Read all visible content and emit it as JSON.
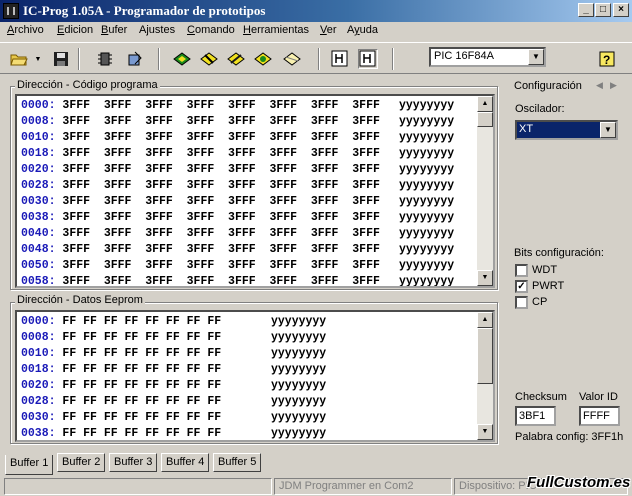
{
  "window": {
    "title": "IC-Prog 1.05A - Programador de prototipos",
    "buttons": {
      "minimize": "_",
      "maximize": "□",
      "close": "×"
    }
  },
  "menu": {
    "items": [
      {
        "label": "Archivo",
        "accel": "A"
      },
      {
        "label": "Edicion",
        "accel": "E"
      },
      {
        "label": "Bufer",
        "accel": "B"
      },
      {
        "label": "Ajustes",
        "accel": "j"
      },
      {
        "label": "Comando",
        "accel": "C"
      },
      {
        "label": "Herramientas",
        "accel": "H"
      },
      {
        "label": "Ver",
        "accel": "V"
      },
      {
        "label": "Ayuda",
        "accel": "y"
      }
    ]
  },
  "toolbar": {
    "icons": [
      "open-folder-icon",
      "dropdown-arrow-icon",
      "save-disk-icon",
      "read-chip-icon",
      "write-chip-icon",
      "read-device-icon",
      "program-device-icon",
      "erase-device-icon",
      "verify-device-icon",
      "blank-check-icon",
      "view-hex-icon",
      "view-asm-icon",
      "help-icon"
    ],
    "device": "PIC 16F84A"
  },
  "code_panel": {
    "title": "Dirección - Código programa",
    "rows": [
      {
        "addr": "0000:",
        "words": "3FFF  3FFF  3FFF  3FFF  3FFF  3FFF  3FFF  3FFF",
        "ascii": "yyyyyyyy"
      },
      {
        "addr": "0008:",
        "words": "3FFF  3FFF  3FFF  3FFF  3FFF  3FFF  3FFF  3FFF",
        "ascii": "yyyyyyyy"
      },
      {
        "addr": "0010:",
        "words": "3FFF  3FFF  3FFF  3FFF  3FFF  3FFF  3FFF  3FFF",
        "ascii": "yyyyyyyy"
      },
      {
        "addr": "0018:",
        "words": "3FFF  3FFF  3FFF  3FFF  3FFF  3FFF  3FFF  3FFF",
        "ascii": "yyyyyyyy"
      },
      {
        "addr": "0020:",
        "words": "3FFF  3FFF  3FFF  3FFF  3FFF  3FFF  3FFF  3FFF",
        "ascii": "yyyyyyyy"
      },
      {
        "addr": "0028:",
        "words": "3FFF  3FFF  3FFF  3FFF  3FFF  3FFF  3FFF  3FFF",
        "ascii": "yyyyyyyy"
      },
      {
        "addr": "0030:",
        "words": "3FFF  3FFF  3FFF  3FFF  3FFF  3FFF  3FFF  3FFF",
        "ascii": "yyyyyyyy"
      },
      {
        "addr": "0038:",
        "words": "3FFF  3FFF  3FFF  3FFF  3FFF  3FFF  3FFF  3FFF",
        "ascii": "yyyyyyyy"
      },
      {
        "addr": "0040:",
        "words": "3FFF  3FFF  3FFF  3FFF  3FFF  3FFF  3FFF  3FFF",
        "ascii": "yyyyyyyy"
      },
      {
        "addr": "0048:",
        "words": "3FFF  3FFF  3FFF  3FFF  3FFF  3FFF  3FFF  3FFF",
        "ascii": "yyyyyyyy"
      },
      {
        "addr": "0050:",
        "words": "3FFF  3FFF  3FFF  3FFF  3FFF  3FFF  3FFF  3FFF",
        "ascii": "yyyyyyyy"
      },
      {
        "addr": "0058:",
        "words": "3FFF  3FFF  3FFF  3FFF  3FFF  3FFF  3FFF  3FFF",
        "ascii": "yyyyyyyy"
      }
    ]
  },
  "eeprom_panel": {
    "title": "Dirección - Datos Eeprom",
    "rows": [
      {
        "addr": "0000:",
        "bytes": "FF FF FF FF FF FF FF FF",
        "ascii": "yyyyyyyy"
      },
      {
        "addr": "0008:",
        "bytes": "FF FF FF FF FF FF FF FF",
        "ascii": "yyyyyyyy"
      },
      {
        "addr": "0010:",
        "bytes": "FF FF FF FF FF FF FF FF",
        "ascii": "yyyyyyyy"
      },
      {
        "addr": "0018:",
        "bytes": "FF FF FF FF FF FF FF FF",
        "ascii": "yyyyyyyy"
      },
      {
        "addr": "0020:",
        "bytes": "FF FF FF FF FF FF FF FF",
        "ascii": "yyyyyyyy"
      },
      {
        "addr": "0028:",
        "bytes": "FF FF FF FF FF FF FF FF",
        "ascii": "yyyyyyyy"
      },
      {
        "addr": "0030:",
        "bytes": "FF FF FF FF FF FF FF FF",
        "ascii": "yyyyyyyy"
      },
      {
        "addr": "0038:",
        "bytes": "FF FF FF FF FF FF FF FF",
        "ascii": "yyyyyyyy"
      }
    ]
  },
  "config_panel": {
    "title": "Configuración",
    "oscillator_label": "Oscilador:",
    "oscillator_value": "XT",
    "bits_label": "Bits configuración:",
    "bits": [
      {
        "name": "WDT",
        "checked": false
      },
      {
        "name": "PWRT",
        "checked": true
      },
      {
        "name": "CP",
        "checked": false
      }
    ],
    "checksum_label": "Checksum",
    "checksum_value": "3BF1",
    "id_label": "Valor ID",
    "id_value": "FFFF",
    "config_word": "Palabra config: 3FF1h"
  },
  "tabs": [
    "Buffer 1",
    "Buffer 2",
    "Buffer 3",
    "Buffer 4",
    "Buffer 5"
  ],
  "status": {
    "hardware": "JDM Programmer en Com2",
    "device": "Dispositivo: PIC"
  },
  "watermark": "FullCustom.es",
  "colors": {
    "title_start": "#0a246a",
    "title_end": "#a6caf0",
    "address": "#1a1ab8",
    "face": "#d4d0c8"
  }
}
